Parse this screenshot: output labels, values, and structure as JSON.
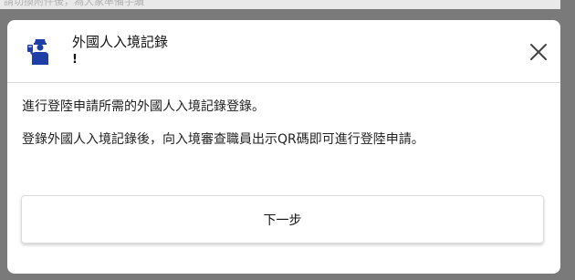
{
  "background": {
    "partial_text": "請切換附件後，為大家準備手續"
  },
  "dialog": {
    "icon": "immigration-officer-icon",
    "title": "外國人入境記錄",
    "subtitle": "!",
    "close_icon": "close-icon",
    "body_lines": [
      "進行登陸申請所需的外國人入境記錄登錄。",
      "登錄外國人入境記錄後，向入境審查職員出示QR碼即可進行登陸申請。"
    ],
    "next_button_label": "下一步"
  },
  "colors": {
    "overlay": "#7a7a7a",
    "dialog_bg": "#ffffff",
    "icon_blue": "#1f3fa6",
    "divider": "#d9d9d9"
  }
}
